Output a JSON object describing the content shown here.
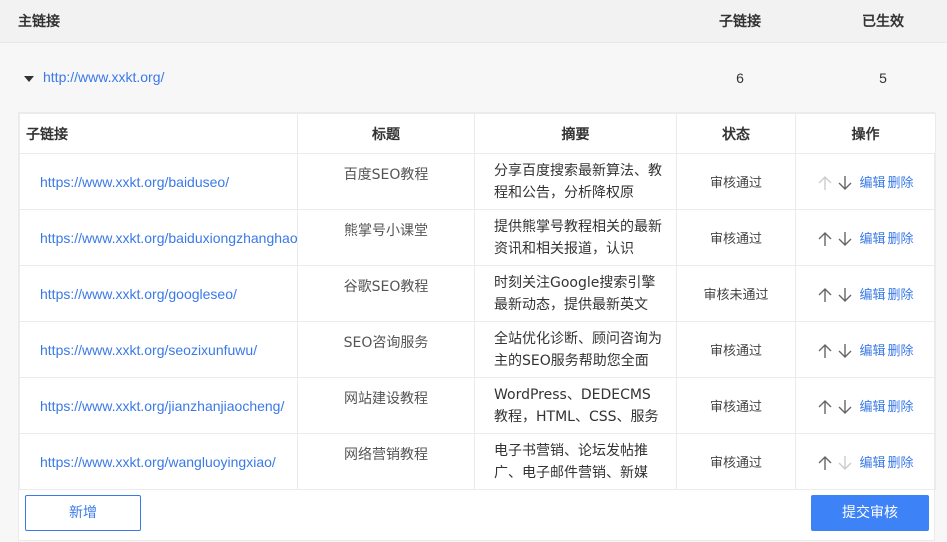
{
  "header": {
    "main_link": "主链接",
    "sub_links": "子链接",
    "effective": "已生效"
  },
  "group": {
    "url": "http://www.xxkt.org/",
    "sub_count": "6",
    "effective_count": "5"
  },
  "table": {
    "columns": [
      "子链接",
      "标题",
      "摘要",
      "状态",
      "操作"
    ],
    "rows": [
      {
        "url": "https://www.xxkt.org/baiduseo/",
        "title": "百度SEO教程",
        "desc": "分享百度搜索最新算法、教程和公告，分析降权原",
        "status": "审核通过",
        "edit": "编辑",
        "delete": "删除",
        "up_enabled": false,
        "down_enabled": true
      },
      {
        "url": "https://www.xxkt.org/baiduxiongzhanghao/",
        "title": "熊掌号小课堂",
        "desc": "提供熊掌号教程相关的最新资讯和相关报道，认识",
        "status": "审核通过",
        "edit": "编辑",
        "delete": "删除",
        "up_enabled": true,
        "down_enabled": true
      },
      {
        "url": "https://www.xxkt.org/googleseo/",
        "title": "谷歌SEO教程",
        "desc": "时刻关注Google搜索引擎最新动态，提供最新英文",
        "status": "审核未通过",
        "edit": "编辑",
        "delete": "删除",
        "up_enabled": true,
        "down_enabled": true
      },
      {
        "url": "https://www.xxkt.org/seozixunfuwu/",
        "title": "SEO咨询服务",
        "desc": "全站优化诊断、顾问咨询为主的SEO服务帮助您全面",
        "status": "审核通过",
        "edit": "编辑",
        "delete": "删除",
        "up_enabled": true,
        "down_enabled": true
      },
      {
        "url": "https://www.xxkt.org/jianzhanjiaocheng/",
        "title": "网站建设教程",
        "desc": "WordPress、DEDECMS教程，HTML、CSS、服务器环",
        "status": "审核通过",
        "edit": "编辑",
        "delete": "删除",
        "up_enabled": true,
        "down_enabled": true
      },
      {
        "url": "https://www.xxkt.org/wangluoyingxiao/",
        "title": "网络营销教程",
        "desc": "电子书营销、论坛发帖推广、电子邮件营销、新媒",
        "status": "审核通过",
        "edit": "编辑",
        "delete": "删除",
        "up_enabled": true,
        "down_enabled": false
      }
    ]
  },
  "buttons": {
    "add": "新增",
    "submit": "提交审核"
  },
  "colors": {
    "link": "#3a79e8",
    "primary": "#3d82f6",
    "disabled_arrow": "#cccccc",
    "arrow": "#666666"
  }
}
